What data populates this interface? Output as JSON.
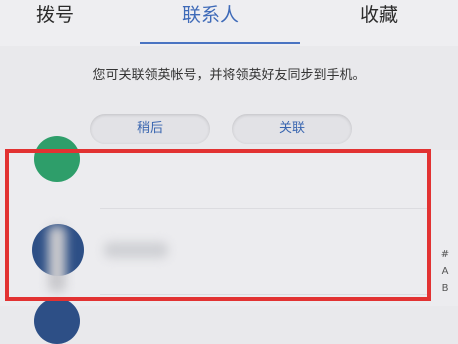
{
  "tabs": [
    {
      "label": "拨号",
      "active": false
    },
    {
      "label": "联系人",
      "active": true
    },
    {
      "label": "收藏",
      "active": false
    }
  ],
  "notice": "您可关联领英帐号，并将领英好友同步到手机。",
  "buttons": {
    "later": "稍后",
    "link": "关联"
  },
  "index_bar": [
    "#",
    "A",
    "B"
  ],
  "colors": {
    "accent": "#3e6ab8",
    "highlight_border": "#e23232",
    "avatar_green": "#2e9e6a",
    "avatar_navy": "#2d4f86"
  }
}
